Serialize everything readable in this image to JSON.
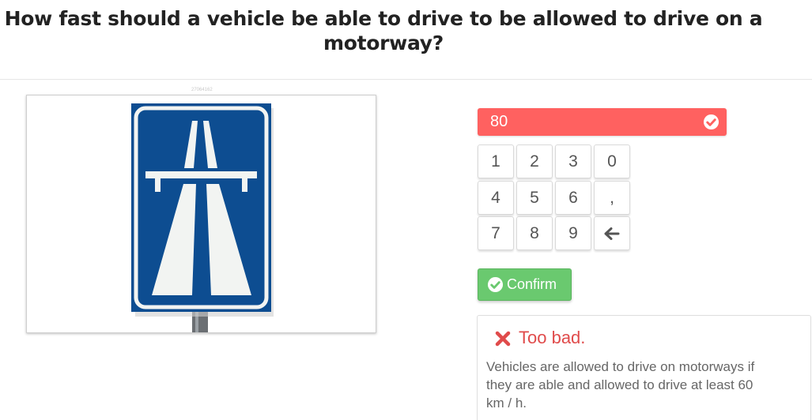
{
  "question": {
    "line1": "How fast should a vehicle be able to drive to be allowed to drive on a",
    "line2": "motorway?"
  },
  "image": {
    "id_label": "27064162",
    "sign": "motorway-sign",
    "sign_color": "#0d4d91"
  },
  "answer": {
    "value": "80",
    "status_color": "#ff6160"
  },
  "keypad": {
    "keys": [
      "1",
      "2",
      "3",
      "0",
      "4",
      "5",
      "6",
      ",",
      "7",
      "8",
      "9",
      "backspace-icon"
    ]
  },
  "confirm": {
    "label": "Confirm",
    "color": "#6ac96f"
  },
  "feedback": {
    "title": "Too bad.",
    "title_color": "#e04b4b",
    "line1": "Vehicles are allowed to drive on motorways if",
    "line2": "they are able and allowed to drive at least 60",
    "line3": "km / h."
  }
}
